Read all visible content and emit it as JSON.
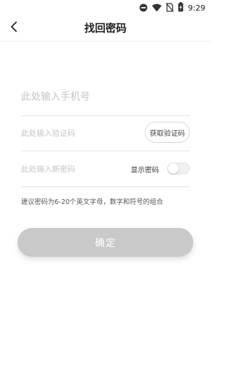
{
  "status_bar": {
    "time": "9:29",
    "icons": [
      "do-not-disturb-icon",
      "wifi-icon",
      "no-sim-icon",
      "battery-charging-icon"
    ]
  },
  "header": {
    "back_icon": "chevron-left-icon",
    "title": "找回密码"
  },
  "form": {
    "phone_placeholder": "此处输入手机号",
    "phone_value": "",
    "code_placeholder": "此处输入验证码",
    "code_value": "",
    "get_code_label": "获取验证码",
    "new_password_placeholder": "此处输入新密码",
    "new_password_value": "",
    "show_password_label": "显示密码",
    "show_password_on": false
  },
  "hint": "建议密码为6-20个英文字母，数字和符号的组合",
  "confirm_label": "确定",
  "colors": {
    "confirm_button_bg": "#c9c9c9",
    "placeholder": "#c4c4c4",
    "divider": "#e2e2e2"
  }
}
